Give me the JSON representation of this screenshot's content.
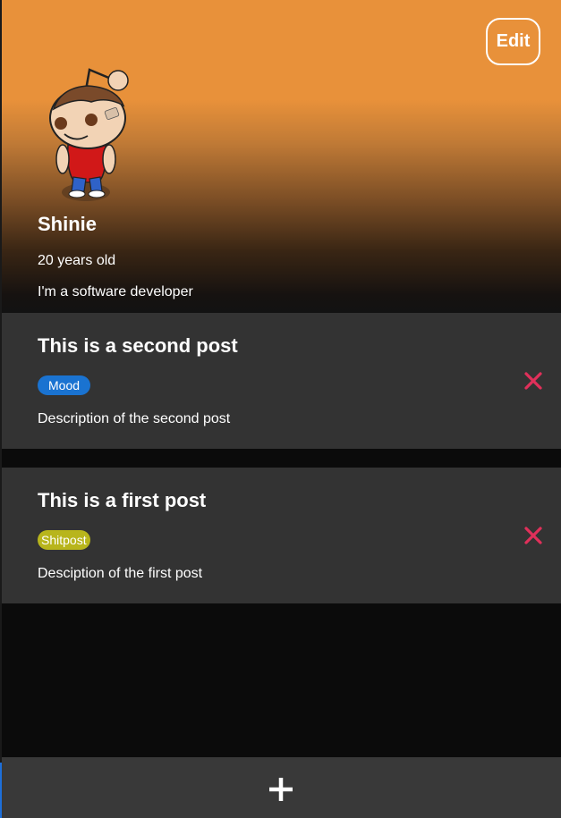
{
  "profile": {
    "edit_label": "Edit",
    "name": "Shinie",
    "age": "20 years old",
    "bio": "I'm a software developer"
  },
  "posts": [
    {
      "title": "This is a second post",
      "tag": "Mood",
      "tag_color": "#1a73d1",
      "description": "Description of the second post"
    },
    {
      "title": "This is a first post",
      "tag": "Shitpost",
      "tag_color": "#b8b51c",
      "description": "Desciption of the first post"
    }
  ],
  "colors": {
    "header_accent": "#e8913a",
    "card_background": "#333333",
    "delete_icon": "#e0305a",
    "page_background": "#0b0b0b"
  },
  "icons": {
    "delete": "close-icon",
    "add": "plus-icon",
    "avatar": "reddit-snoo-avatar"
  }
}
